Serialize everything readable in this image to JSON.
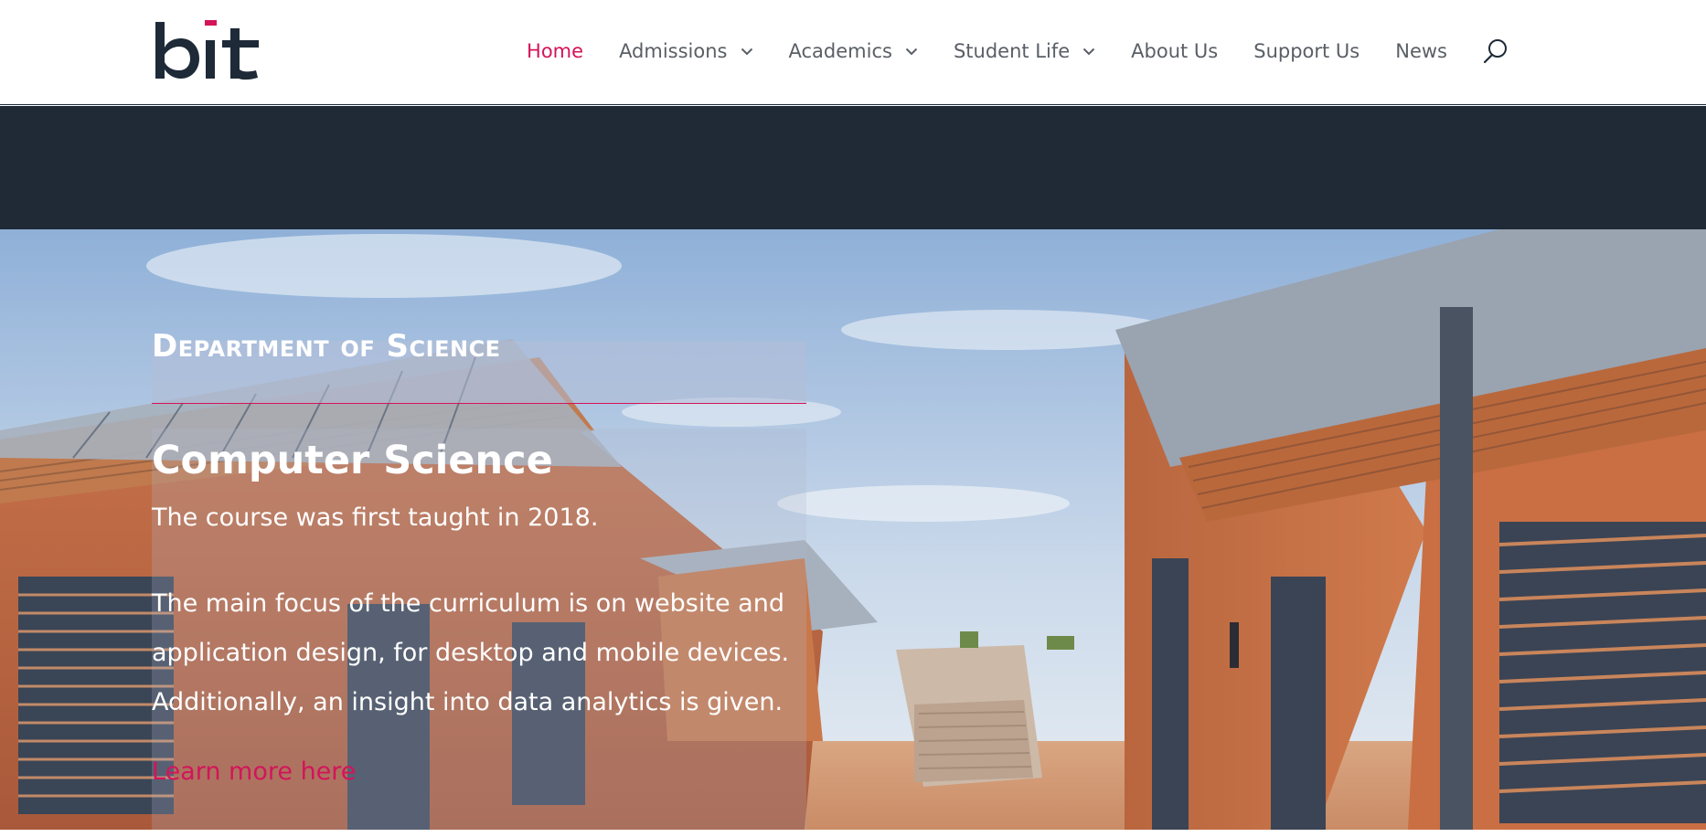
{
  "header": {
    "logo_text": "bit",
    "logo_icon": "bit-logo-icon",
    "nav": [
      {
        "label": "Home",
        "active": true,
        "dropdown": false
      },
      {
        "label": "Admissions",
        "active": false,
        "dropdown": true
      },
      {
        "label": "Academics",
        "active": false,
        "dropdown": true
      },
      {
        "label": "Student Life",
        "active": false,
        "dropdown": true
      },
      {
        "label": "About Us",
        "active": false,
        "dropdown": false
      },
      {
        "label": "Support Us",
        "active": false,
        "dropdown": false
      },
      {
        "label": "News",
        "active": false,
        "dropdown": false
      }
    ],
    "search_icon": "search-icon"
  },
  "hero": {
    "department_title": "Department of Science",
    "course": {
      "title": "Computer Science",
      "paragraph_1": "The course was first taught in 2018.",
      "paragraph_2": "The main focus of the curriculum is on website and application design, for desktop and mobile devices. Additionally, an insight into data analytics is given.",
      "link_label": "Learn more here"
    },
    "background_image": "campus-buildings-photo"
  },
  "colors": {
    "accent": "#d4145a",
    "dark_band": "#1f2a36",
    "nav_text": "#5a5f66",
    "logo_dark": "#1e2a38"
  }
}
